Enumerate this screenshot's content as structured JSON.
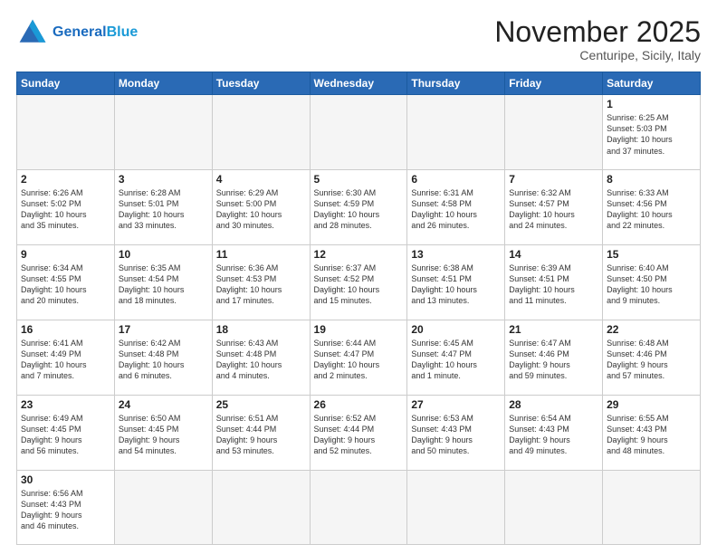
{
  "header": {
    "logo_general": "General",
    "logo_blue": "Blue",
    "month_title": "November 2025",
    "location": "Centuripe, Sicily, Italy"
  },
  "days_of_week": [
    "Sunday",
    "Monday",
    "Tuesday",
    "Wednesday",
    "Thursday",
    "Friday",
    "Saturday"
  ],
  "weeks": [
    [
      {
        "num": "",
        "info": "",
        "empty": true
      },
      {
        "num": "",
        "info": "",
        "empty": true
      },
      {
        "num": "",
        "info": "",
        "empty": true
      },
      {
        "num": "",
        "info": "",
        "empty": true
      },
      {
        "num": "",
        "info": "",
        "empty": true
      },
      {
        "num": "",
        "info": "",
        "empty": true
      },
      {
        "num": "1",
        "info": "Sunrise: 6:25 AM\nSunset: 5:03 PM\nDaylight: 10 hours\nand 37 minutes."
      }
    ],
    [
      {
        "num": "2",
        "info": "Sunrise: 6:26 AM\nSunset: 5:02 PM\nDaylight: 10 hours\nand 35 minutes."
      },
      {
        "num": "3",
        "info": "Sunrise: 6:28 AM\nSunset: 5:01 PM\nDaylight: 10 hours\nand 33 minutes."
      },
      {
        "num": "4",
        "info": "Sunrise: 6:29 AM\nSunset: 5:00 PM\nDaylight: 10 hours\nand 30 minutes."
      },
      {
        "num": "5",
        "info": "Sunrise: 6:30 AM\nSunset: 4:59 PM\nDaylight: 10 hours\nand 28 minutes."
      },
      {
        "num": "6",
        "info": "Sunrise: 6:31 AM\nSunset: 4:58 PM\nDaylight: 10 hours\nand 26 minutes."
      },
      {
        "num": "7",
        "info": "Sunrise: 6:32 AM\nSunset: 4:57 PM\nDaylight: 10 hours\nand 24 minutes."
      },
      {
        "num": "8",
        "info": "Sunrise: 6:33 AM\nSunset: 4:56 PM\nDaylight: 10 hours\nand 22 minutes."
      }
    ],
    [
      {
        "num": "9",
        "info": "Sunrise: 6:34 AM\nSunset: 4:55 PM\nDaylight: 10 hours\nand 20 minutes."
      },
      {
        "num": "10",
        "info": "Sunrise: 6:35 AM\nSunset: 4:54 PM\nDaylight: 10 hours\nand 18 minutes."
      },
      {
        "num": "11",
        "info": "Sunrise: 6:36 AM\nSunset: 4:53 PM\nDaylight: 10 hours\nand 17 minutes."
      },
      {
        "num": "12",
        "info": "Sunrise: 6:37 AM\nSunset: 4:52 PM\nDaylight: 10 hours\nand 15 minutes."
      },
      {
        "num": "13",
        "info": "Sunrise: 6:38 AM\nSunset: 4:51 PM\nDaylight: 10 hours\nand 13 minutes."
      },
      {
        "num": "14",
        "info": "Sunrise: 6:39 AM\nSunset: 4:51 PM\nDaylight: 10 hours\nand 11 minutes."
      },
      {
        "num": "15",
        "info": "Sunrise: 6:40 AM\nSunset: 4:50 PM\nDaylight: 10 hours\nand 9 minutes."
      }
    ],
    [
      {
        "num": "16",
        "info": "Sunrise: 6:41 AM\nSunset: 4:49 PM\nDaylight: 10 hours\nand 7 minutes."
      },
      {
        "num": "17",
        "info": "Sunrise: 6:42 AM\nSunset: 4:48 PM\nDaylight: 10 hours\nand 6 minutes."
      },
      {
        "num": "18",
        "info": "Sunrise: 6:43 AM\nSunset: 4:48 PM\nDaylight: 10 hours\nand 4 minutes."
      },
      {
        "num": "19",
        "info": "Sunrise: 6:44 AM\nSunset: 4:47 PM\nDaylight: 10 hours\nand 2 minutes."
      },
      {
        "num": "20",
        "info": "Sunrise: 6:45 AM\nSunset: 4:47 PM\nDaylight: 10 hours\nand 1 minute."
      },
      {
        "num": "21",
        "info": "Sunrise: 6:47 AM\nSunset: 4:46 PM\nDaylight: 9 hours\nand 59 minutes."
      },
      {
        "num": "22",
        "info": "Sunrise: 6:48 AM\nSunset: 4:46 PM\nDaylight: 9 hours\nand 57 minutes."
      }
    ],
    [
      {
        "num": "23",
        "info": "Sunrise: 6:49 AM\nSunset: 4:45 PM\nDaylight: 9 hours\nand 56 minutes."
      },
      {
        "num": "24",
        "info": "Sunrise: 6:50 AM\nSunset: 4:45 PM\nDaylight: 9 hours\nand 54 minutes."
      },
      {
        "num": "25",
        "info": "Sunrise: 6:51 AM\nSunset: 4:44 PM\nDaylight: 9 hours\nand 53 minutes."
      },
      {
        "num": "26",
        "info": "Sunrise: 6:52 AM\nSunset: 4:44 PM\nDaylight: 9 hours\nand 52 minutes."
      },
      {
        "num": "27",
        "info": "Sunrise: 6:53 AM\nSunset: 4:43 PM\nDaylight: 9 hours\nand 50 minutes."
      },
      {
        "num": "28",
        "info": "Sunrise: 6:54 AM\nSunset: 4:43 PM\nDaylight: 9 hours\nand 49 minutes."
      },
      {
        "num": "29",
        "info": "Sunrise: 6:55 AM\nSunset: 4:43 PM\nDaylight: 9 hours\nand 48 minutes."
      }
    ],
    [
      {
        "num": "30",
        "info": "Sunrise: 6:56 AM\nSunset: 4:43 PM\nDaylight: 9 hours\nand 46 minutes."
      },
      {
        "num": "",
        "info": "",
        "empty": true
      },
      {
        "num": "",
        "info": "",
        "empty": true
      },
      {
        "num": "",
        "info": "",
        "empty": true
      },
      {
        "num": "",
        "info": "",
        "empty": true
      },
      {
        "num": "",
        "info": "",
        "empty": true
      },
      {
        "num": "",
        "info": "",
        "empty": true
      }
    ]
  ]
}
